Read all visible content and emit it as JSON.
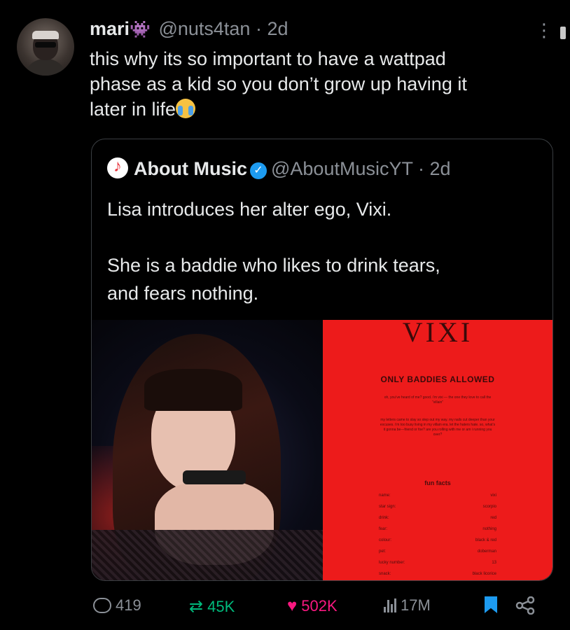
{
  "tweet": {
    "display_name": "mari",
    "name_emoji": "👾",
    "handle": "@nuts4tan",
    "time": "· 2d",
    "text": "this why its so important to have a wattpad\nphase as a kid so you don’t grow up having it\nlater in life",
    "trailing_emoji": "😭",
    "more_icon": "⋮"
  },
  "quote": {
    "display_name": "About Music",
    "handle": "@AboutMusicYT",
    "time": "· 2d",
    "verified_icon": "✓",
    "text": "Lisa introduces her alter ego, Vixi.\n\nShe is a baddie who likes to drink tears,\nand fears nothing."
  },
  "poster": {
    "title": "VIXI",
    "subtitle": "ONLY BADDIES ALLOWED",
    "para1": "oh, you’ve heard of me? good. i’m vixi — the one they love to call the “villain”",
    "para2": "my letters came to slay so step out my way. my nails cut deeper than your excuses. i’m too busy living in my villain era. let the haters hate. so, what’s it gonna be—friend or foe? are you rolling with me or am i running you over?",
    "facts_heading": "fun facts",
    "facts": [
      {
        "k": "name:",
        "v": "vixi"
      },
      {
        "k": "star sign:",
        "v": "scorpio"
      },
      {
        "k": "drink:",
        "v": "red"
      },
      {
        "k": "fear:",
        "v": "nothing"
      },
      {
        "k": "colour:",
        "v": "black & red"
      },
      {
        "k": "pet:",
        "v": "doberman"
      },
      {
        "k": "lucky number:",
        "v": "13"
      },
      {
        "k": "snack:",
        "v": "black licorice"
      }
    ]
  },
  "actions": {
    "replies": "419",
    "retweets": "45K",
    "likes": "502K",
    "views": "17M"
  },
  "colors": {
    "background": "#000000",
    "text": "#e7e9ea",
    "secondary": "#8b9097",
    "retweet": "#00ba7c",
    "like": "#f91880",
    "verified": "#1d9bf0",
    "poster_red": "#ed1b1b"
  }
}
